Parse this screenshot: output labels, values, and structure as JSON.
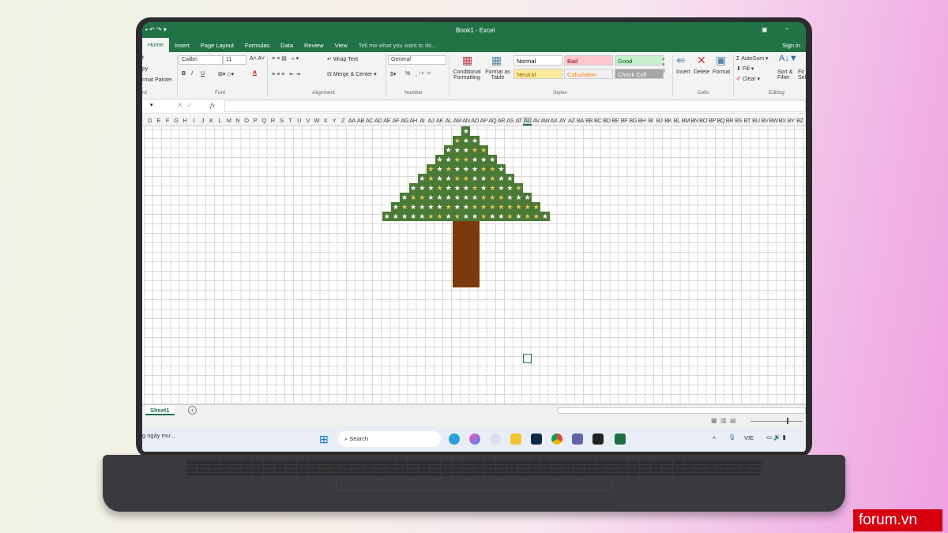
{
  "window": {
    "title": "Book1 - Excel",
    "sign_in": "Sign in"
  },
  "tabs": [
    "Home",
    "Insert",
    "Page Layout",
    "Formulas",
    "Data",
    "Review",
    "View"
  ],
  "tell_me": "Tell me what you want to do...",
  "clipboard": {
    "cut": "t",
    "copy": "py",
    "format_painter": "rmat Painter",
    "group": "rd"
  },
  "font": {
    "name": "Calibri",
    "size": "11",
    "bold": "B",
    "italic": "I",
    "underline": "U",
    "group": "Font"
  },
  "alignment": {
    "wrap": "Wrap Text",
    "merge": "Merge & Center",
    "group": "Alignment"
  },
  "number": {
    "format": "General",
    "percent": "%",
    "group": "Number"
  },
  "styles": {
    "conditional": "Conditional Formatting",
    "format_table": "Format as Table",
    "items": [
      {
        "label": "Normal",
        "bg": "#ffffff",
        "fg": "#000000"
      },
      {
        "label": "Bad",
        "bg": "#ffc7ce",
        "fg": "#9c0006"
      },
      {
        "label": "Good",
        "bg": "#c6efce",
        "fg": "#006100"
      },
      {
        "label": "Neutral",
        "bg": "#ffeb9c",
        "fg": "#9c6500"
      },
      {
        "label": "Calculation",
        "bg": "#f2f2f2",
        "fg": "#fa7d00"
      },
      {
        "label": "Check Cell",
        "bg": "#a5a5a5",
        "fg": "#ffffff"
      }
    ],
    "group": "Styles"
  },
  "cells": {
    "insert": "Insert",
    "delete": "Delete",
    "format": "Format",
    "group": "Cells"
  },
  "editing": {
    "autosum": "AutoSum",
    "fill": "Fill",
    "clear": "Clear",
    "sort": "Sort & Filter",
    "find": "Fir Sel",
    "group": "Editing"
  },
  "formula_bar": {
    "fx": "fx",
    "value": ""
  },
  "columns": [
    "D",
    "E",
    "F",
    "G",
    "H",
    "I",
    "J",
    "K",
    "L",
    "M",
    "N",
    "O",
    "P",
    "Q",
    "R",
    "S",
    "T",
    "U",
    "V",
    "W",
    "X",
    "Y",
    "Z",
    "AA",
    "AB",
    "AC",
    "AD",
    "AE",
    "AF",
    "AG",
    "AH",
    "AI",
    "AJ",
    "AK",
    "AL",
    "AM",
    "AN",
    "AO",
    "AP",
    "AQ",
    "AR",
    "AS",
    "AT",
    "AU",
    "AV",
    "AW",
    "AX",
    "AY",
    "AZ",
    "BA",
    "BB",
    "BC",
    "BD",
    "BE",
    "BF",
    "BG",
    "BH",
    "BI",
    "BJ",
    "BK",
    "BL",
    "BM",
    "BN",
    "BO",
    "BP",
    "BQ",
    "BR",
    "BS",
    "BT",
    "BU",
    "BV",
    "BW",
    "BX",
    "BY",
    "BZ"
  ],
  "selected_column": "AU",
  "tree": {
    "rows": 10,
    "trunk_cells": 3,
    "trunk_rows": 7,
    "leaf_color": "#4a7a35",
    "trunk_color": "#7b3a0c",
    "star_colors": [
      "#ffffff",
      "#e6c35a"
    ],
    "star": "★"
  },
  "sheet": {
    "tab": "Sheet1",
    "add": "+"
  },
  "taskbar": {
    "news": "g ngày mư...",
    "search": "Search",
    "lang": "VIE"
  },
  "brand": {
    "logo": "forum.vn"
  }
}
